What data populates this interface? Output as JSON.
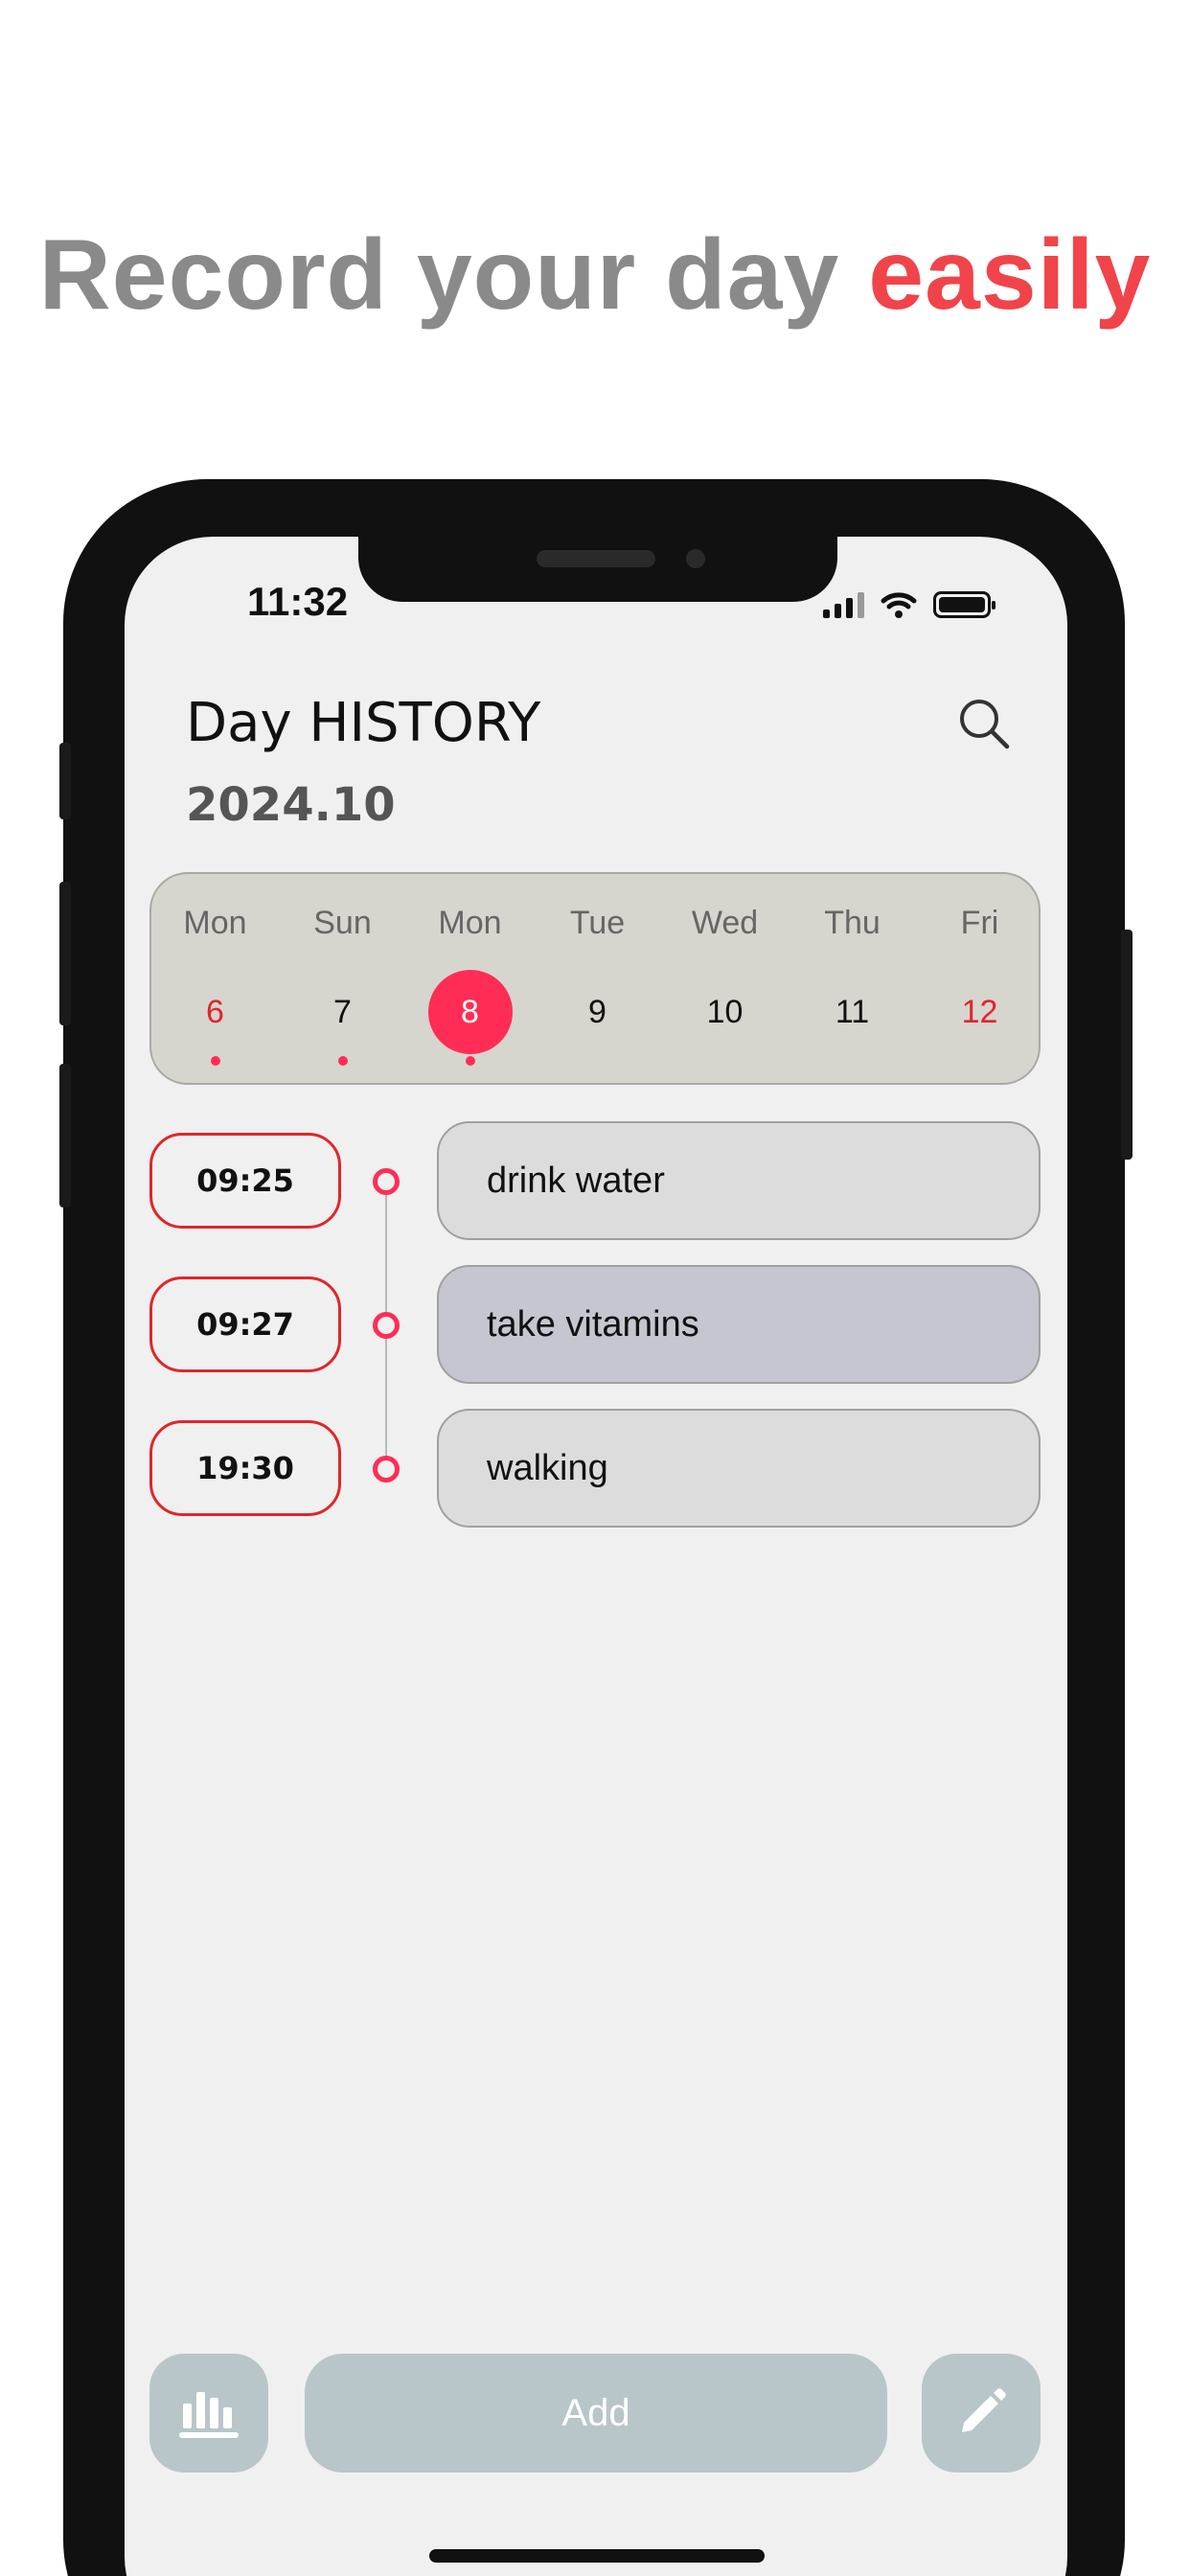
{
  "headline": {
    "part1": "Record your day",
    "part2": "easily"
  },
  "status": {
    "time": "11:32"
  },
  "app": {
    "title": "Day HISTORY",
    "month": "2024.10"
  },
  "week": [
    {
      "name": "Mon",
      "num": "6",
      "color": "red",
      "selected": false,
      "has_dot": true
    },
    {
      "name": "Sun",
      "num": "7",
      "color": "black",
      "selected": false,
      "has_dot": true
    },
    {
      "name": "Mon",
      "num": "8",
      "color": "white",
      "selected": true,
      "has_dot": true
    },
    {
      "name": "Tue",
      "num": "9",
      "color": "black",
      "selected": false,
      "has_dot": false
    },
    {
      "name": "Wed",
      "num": "10",
      "color": "black",
      "selected": false,
      "has_dot": false
    },
    {
      "name": "Thu",
      "num": "11",
      "color": "black",
      "selected": false,
      "has_dot": false
    },
    {
      "name": "Fri",
      "num": "12",
      "color": "red",
      "selected": false,
      "has_dot": false
    }
  ],
  "events": [
    {
      "time": "09:25",
      "label": "drink water",
      "bg": "#dcdcdc"
    },
    {
      "time": "09:27",
      "label": "take vitamins",
      "bg": "#c5c6d0"
    },
    {
      "time": "19:30",
      "label": "walking",
      "bg": "#dcdcdc"
    }
  ],
  "bottom": {
    "add_label": "Add"
  },
  "colors": {
    "accent": "#ff2d55",
    "red_text": "#e0262b",
    "button_bg": "#b9c6c9",
    "headline_red": "#f0444a"
  },
  "icons": {
    "search": "search-icon",
    "stats": "bar-chart-icon",
    "edit": "pencil-icon"
  }
}
